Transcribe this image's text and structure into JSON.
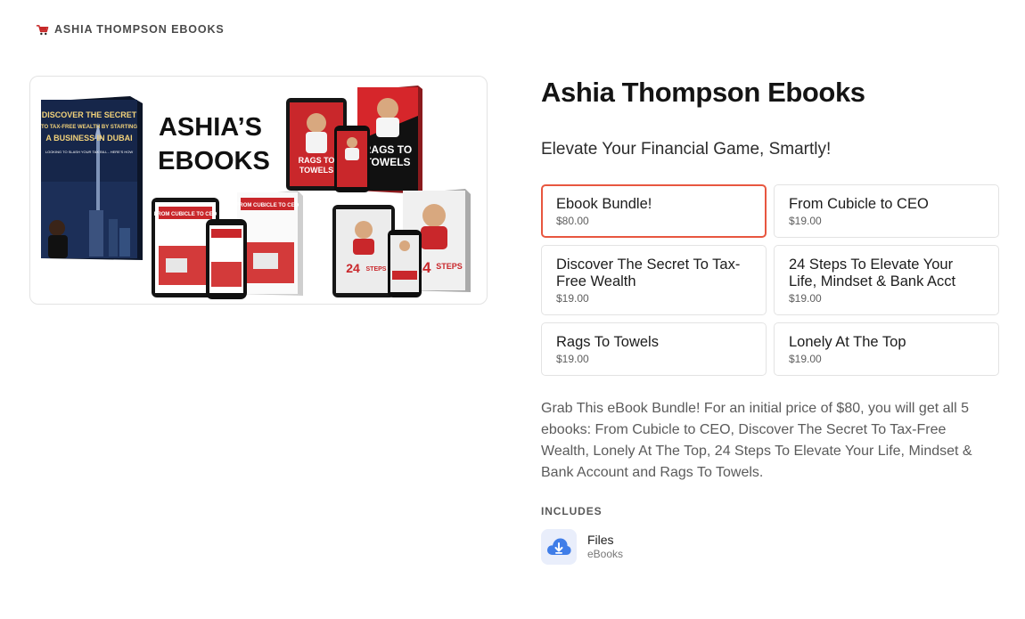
{
  "store": {
    "name": "ASHIA THOMPSON EBOOKS",
    "logo_icon": "shopping-cart-icon"
  },
  "cover": {
    "heading_line1": "ASHIA’S",
    "heading_line2": "EBOOKS",
    "books": {
      "dubai_line1": "DISCOVER THE SECRET",
      "dubai_line2": "TO TAX-FREE WEALTH BY STARTING",
      "dubai_line3": "A BUSINESS IN DUBAI",
      "dubai_tagline": "LOOKING TO SLASH YOUR TAX BILL - HERE'S HOW",
      "rags_line1": "RAGS TO",
      "rags_line2": "TOWELS",
      "cubicle": "FROM CUBICLE TO CEO",
      "steps_number": "24",
      "steps_word": "STEPS"
    }
  },
  "product": {
    "title": "Ashia Thompson Ebooks",
    "subtitle": "Elevate Your Financial Game, Smartly!",
    "options": [
      {
        "name": "Ebook Bundle!",
        "price": "$80.00",
        "selected": true
      },
      {
        "name": "From Cubicle to CEO",
        "price": "$19.00",
        "selected": false
      },
      {
        "name": "Discover The Secret To Tax-Free Wealth",
        "price": "$19.00",
        "selected": false
      },
      {
        "name": "24 Steps To Elevate Your Life, Mindset & Bank Acct",
        "price": "$19.00",
        "selected": false
      },
      {
        "name": "Rags To Towels",
        "price": "$19.00",
        "selected": false
      },
      {
        "name": "Lonely At The Top",
        "price": "$19.00",
        "selected": false
      }
    ],
    "description": "Grab This eBook Bundle! For an initial price of $80, you will get all 5 ebooks: From Cubicle to CEO, Discover The Secret To Tax-Free Wealth, Lonely At The Top, 24 Steps To Elevate Your Life, Mindset & Bank Account and Rags To Towels.",
    "includes": {
      "label": "INCLUDES",
      "items": [
        {
          "name": "Files",
          "type": "eBooks",
          "icon": "cloud-download-icon"
        }
      ]
    }
  },
  "colors": {
    "accent": "#e8563f",
    "book_red": "#d6262b",
    "book_navy": "#14213d",
    "icon_blue": "#3f7de8"
  }
}
